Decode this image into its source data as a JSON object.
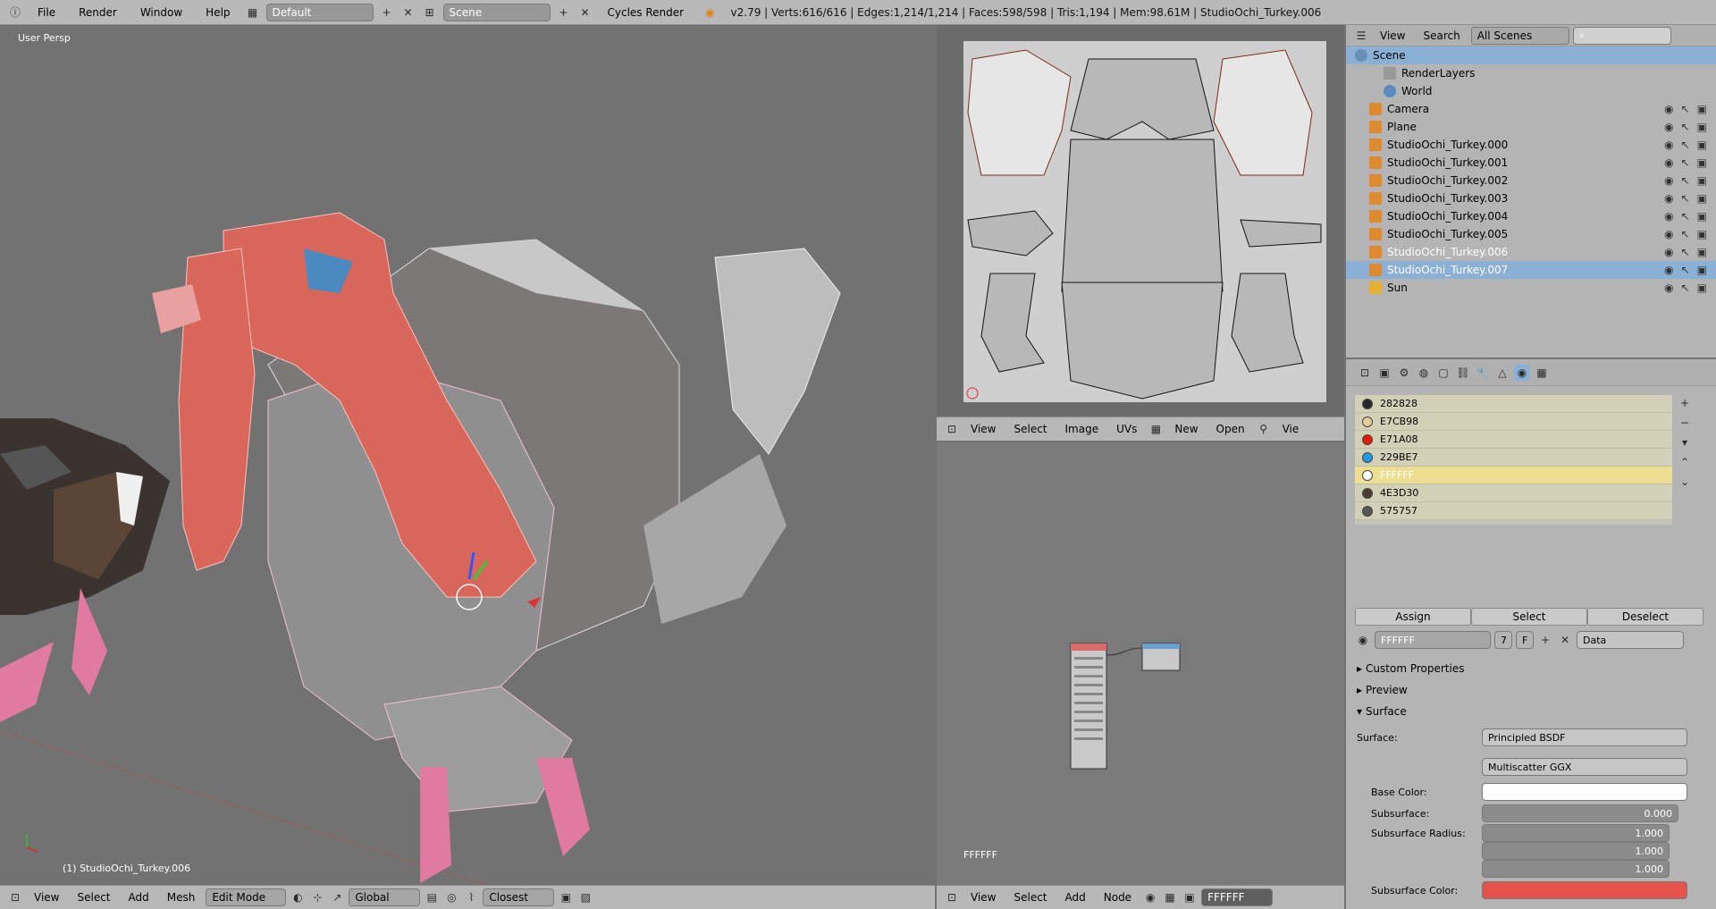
{
  "topbar": {
    "menus": [
      "File",
      "Render",
      "Window",
      "Help"
    ],
    "layout": "Default",
    "scene": "Scene",
    "engine": "Cycles Render",
    "stats": "v2.79 | Verts:616/616 | Edges:1,214/1,214 | Faces:598/598 | Tris:1,194 | Mem:98.61M | StudioOchi_Turkey.006"
  },
  "viewport": {
    "label": "User Persp",
    "object": "(1) StudioOchi_Turkey.006",
    "header": {
      "items": [
        "View",
        "Select",
        "Add",
        "Mesh"
      ],
      "mode": "Edit Mode",
      "orientation": "Global",
      "snap": "Closest"
    }
  },
  "uv_editor": {
    "header": {
      "items": [
        "View",
        "Select",
        "Image",
        "UVs"
      ],
      "new": "New",
      "open": "Open",
      "more": "Vie"
    }
  },
  "node_editor": {
    "label": "FFFFFF",
    "header": {
      "items": [
        "View",
        "Select",
        "Add",
        "Node"
      ],
      "material": "FFFFFF"
    }
  },
  "outliner": {
    "header": {
      "view": "View",
      "search": "Search",
      "filter": "All Scenes"
    },
    "scene": "Scene",
    "rows": [
      {
        "name": "RenderLayers",
        "indent": 2,
        "icon": "renderlayers"
      },
      {
        "name": "World",
        "indent": 2,
        "icon": "world"
      },
      {
        "name": "Camera",
        "indent": 1,
        "icon": "camera"
      },
      {
        "name": "Plane",
        "indent": 1,
        "icon": "mesh"
      },
      {
        "name": "StudioOchi_Turkey.000",
        "indent": 1,
        "icon": "mesh"
      },
      {
        "name": "StudioOchi_Turkey.001",
        "indent": 1,
        "icon": "mesh"
      },
      {
        "name": "StudioOchi_Turkey.002",
        "indent": 1,
        "icon": "mesh"
      },
      {
        "name": "StudioOchi_Turkey.003",
        "indent": 1,
        "icon": "mesh"
      },
      {
        "name": "StudioOchi_Turkey.004",
        "indent": 1,
        "icon": "mesh"
      },
      {
        "name": "StudioOchi_Turkey.005",
        "indent": 1,
        "icon": "mesh"
      },
      {
        "name": "StudioOchi_Turkey.006",
        "indent": 1,
        "icon": "mesh",
        "active": true
      },
      {
        "name": "StudioOchi_Turkey.007",
        "indent": 1,
        "icon": "mesh",
        "selected": true
      },
      {
        "name": "Sun",
        "indent": 1,
        "icon": "lamp"
      }
    ]
  },
  "properties": {
    "slots": [
      {
        "name": "282828",
        "color": "#282828"
      },
      {
        "name": "E7CB98",
        "color": "#E7CB98"
      },
      {
        "name": "E71A08",
        "color": "#E71A08"
      },
      {
        "name": "229BE7",
        "color": "#229BE7"
      },
      {
        "name": "FFFFFF",
        "color": "#FFFFFF",
        "active": true
      },
      {
        "name": "4E3D30",
        "color": "#4E3D30"
      },
      {
        "name": "575757",
        "color": "#575757"
      }
    ],
    "assign": "Assign",
    "select": "Select",
    "deselect": "Deselect",
    "material_name": "FFFFFF",
    "users": "7",
    "fake": "F",
    "link": "Data",
    "panels": {
      "custom": "Custom Properties",
      "preview": "Preview",
      "surface": "Surface"
    },
    "surface": {
      "surface_label": "Surface:",
      "surface_value": "Principled BSDF",
      "distribution": "Multiscatter GGX",
      "base_color_label": "Base Color:",
      "subsurface_label": "Subsurface:",
      "subsurface_value": "0.000",
      "radius_label": "Subsurface Radius:",
      "radius": [
        "1.000",
        "1.000",
        "1.000"
      ],
      "subsurface_color_label": "Subsurface Color:"
    }
  },
  "colors": {
    "mesh_red": "#d9665a",
    "mesh_gray": "#8d8d8d",
    "vertex_pink": "#ff5ea6",
    "selection_blue": "#8ab0d6",
    "subsurface_color": "#e6524c"
  }
}
